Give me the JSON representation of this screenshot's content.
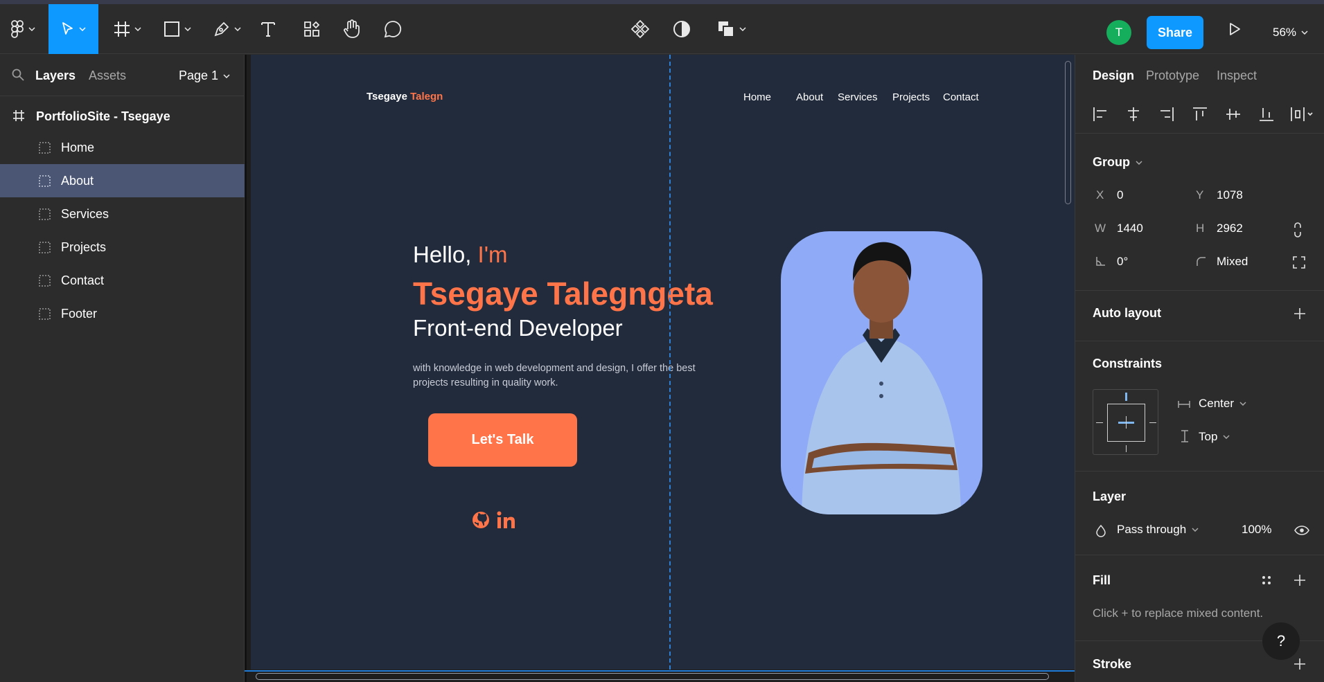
{
  "toolbar": {
    "tools": [
      "main-menu",
      "move-tool",
      "frame-tool",
      "shape-tool",
      "pen-tool",
      "text-tool",
      "resources-tool",
      "hand-tool",
      "comment-tool"
    ],
    "center_tools": [
      "component-icon",
      "mask-icon",
      "boolean-icon"
    ],
    "avatar_initial": "T",
    "share_label": "Share",
    "zoom": "56%",
    "colors": {
      "accent": "#0d99ff",
      "avatar": "#14ae5c"
    }
  },
  "left_panel": {
    "tab_layers": "Layers",
    "tab_assets": "Assets",
    "page": "Page 1",
    "frame_name": "PortfolioSite - Tsegaye",
    "layers": [
      {
        "label": "Home",
        "selected": false
      },
      {
        "label": "About",
        "selected": true
      },
      {
        "label": "Services",
        "selected": false
      },
      {
        "label": "Projects",
        "selected": false
      },
      {
        "label": "Contact",
        "selected": false
      },
      {
        "label": "Footer",
        "selected": false
      }
    ]
  },
  "canvas": {
    "logo_first": "Tsegaye",
    "logo_second": "Talegn",
    "nav": [
      "Home",
      "About",
      "Services",
      "Projects",
      "Contact"
    ],
    "hello": "Hello,",
    "im": "I'm",
    "name": "Tsegaye Talegngeta",
    "role": "Front-end Developer",
    "description": "with knowledge in web development and design, I offer the best projects resulting in quality work.",
    "cta": "Let's Talk",
    "social": [
      "github-icon",
      "linkedin-icon"
    ],
    "colors": {
      "bg": "#222b3c",
      "accent": "#ff7549",
      "photo_bg": "#8fabf7"
    }
  },
  "right_panel": {
    "tabs": [
      "Design",
      "Prototype",
      "Inspect"
    ],
    "group_title": "Group",
    "x_label": "X",
    "x_value": "0",
    "y_label": "Y",
    "y_value": "1078",
    "w_label": "W",
    "w_value": "1440",
    "h_label": "H",
    "h_value": "2962",
    "rotation_value": "0°",
    "radius_value": "Mixed",
    "auto_layout": "Auto layout",
    "constraints": "Constraints",
    "constraint_h": "Center",
    "constraint_v": "Top",
    "layer_title": "Layer",
    "blend": "Pass through",
    "opacity": "100%",
    "fill_title": "Fill",
    "fill_hint": "Click + to replace mixed content.",
    "stroke_title": "Stroke",
    "help": "?"
  }
}
